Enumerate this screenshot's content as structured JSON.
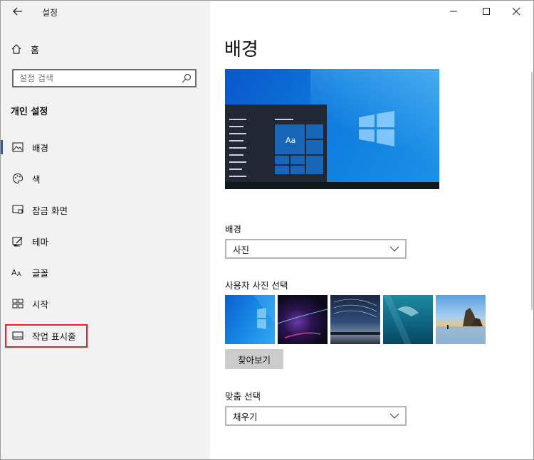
{
  "window": {
    "title": "설정"
  },
  "sidebar": {
    "home_label": "홈",
    "search_placeholder": "설정 검색",
    "section_title": "개인 설정",
    "items": [
      {
        "label": "배경",
        "icon": "image-icon",
        "active": true
      },
      {
        "label": "색",
        "icon": "palette-icon"
      },
      {
        "label": "잠금 화면",
        "icon": "lock-screen-icon"
      },
      {
        "label": "테마",
        "icon": "theme-icon"
      },
      {
        "label": "글꼴",
        "icon": "font-icon"
      },
      {
        "label": "시작",
        "icon": "start-icon"
      },
      {
        "label": "작업 표시줄",
        "icon": "taskbar-icon"
      }
    ]
  },
  "content": {
    "page_title": "배경",
    "preview": {
      "sample_text": "Aa"
    },
    "background_label": "배경",
    "background_value": "사진",
    "choose_picture_label": "사용자 사진 선택",
    "browse_label": "찾아보기",
    "fit_label": "맞춤 선택",
    "fit_value": "채우기"
  },
  "colors": {
    "accent": "#2b5fb5",
    "highlight": "#e3262d",
    "sidebar_bg": "#f2f2f2"
  }
}
